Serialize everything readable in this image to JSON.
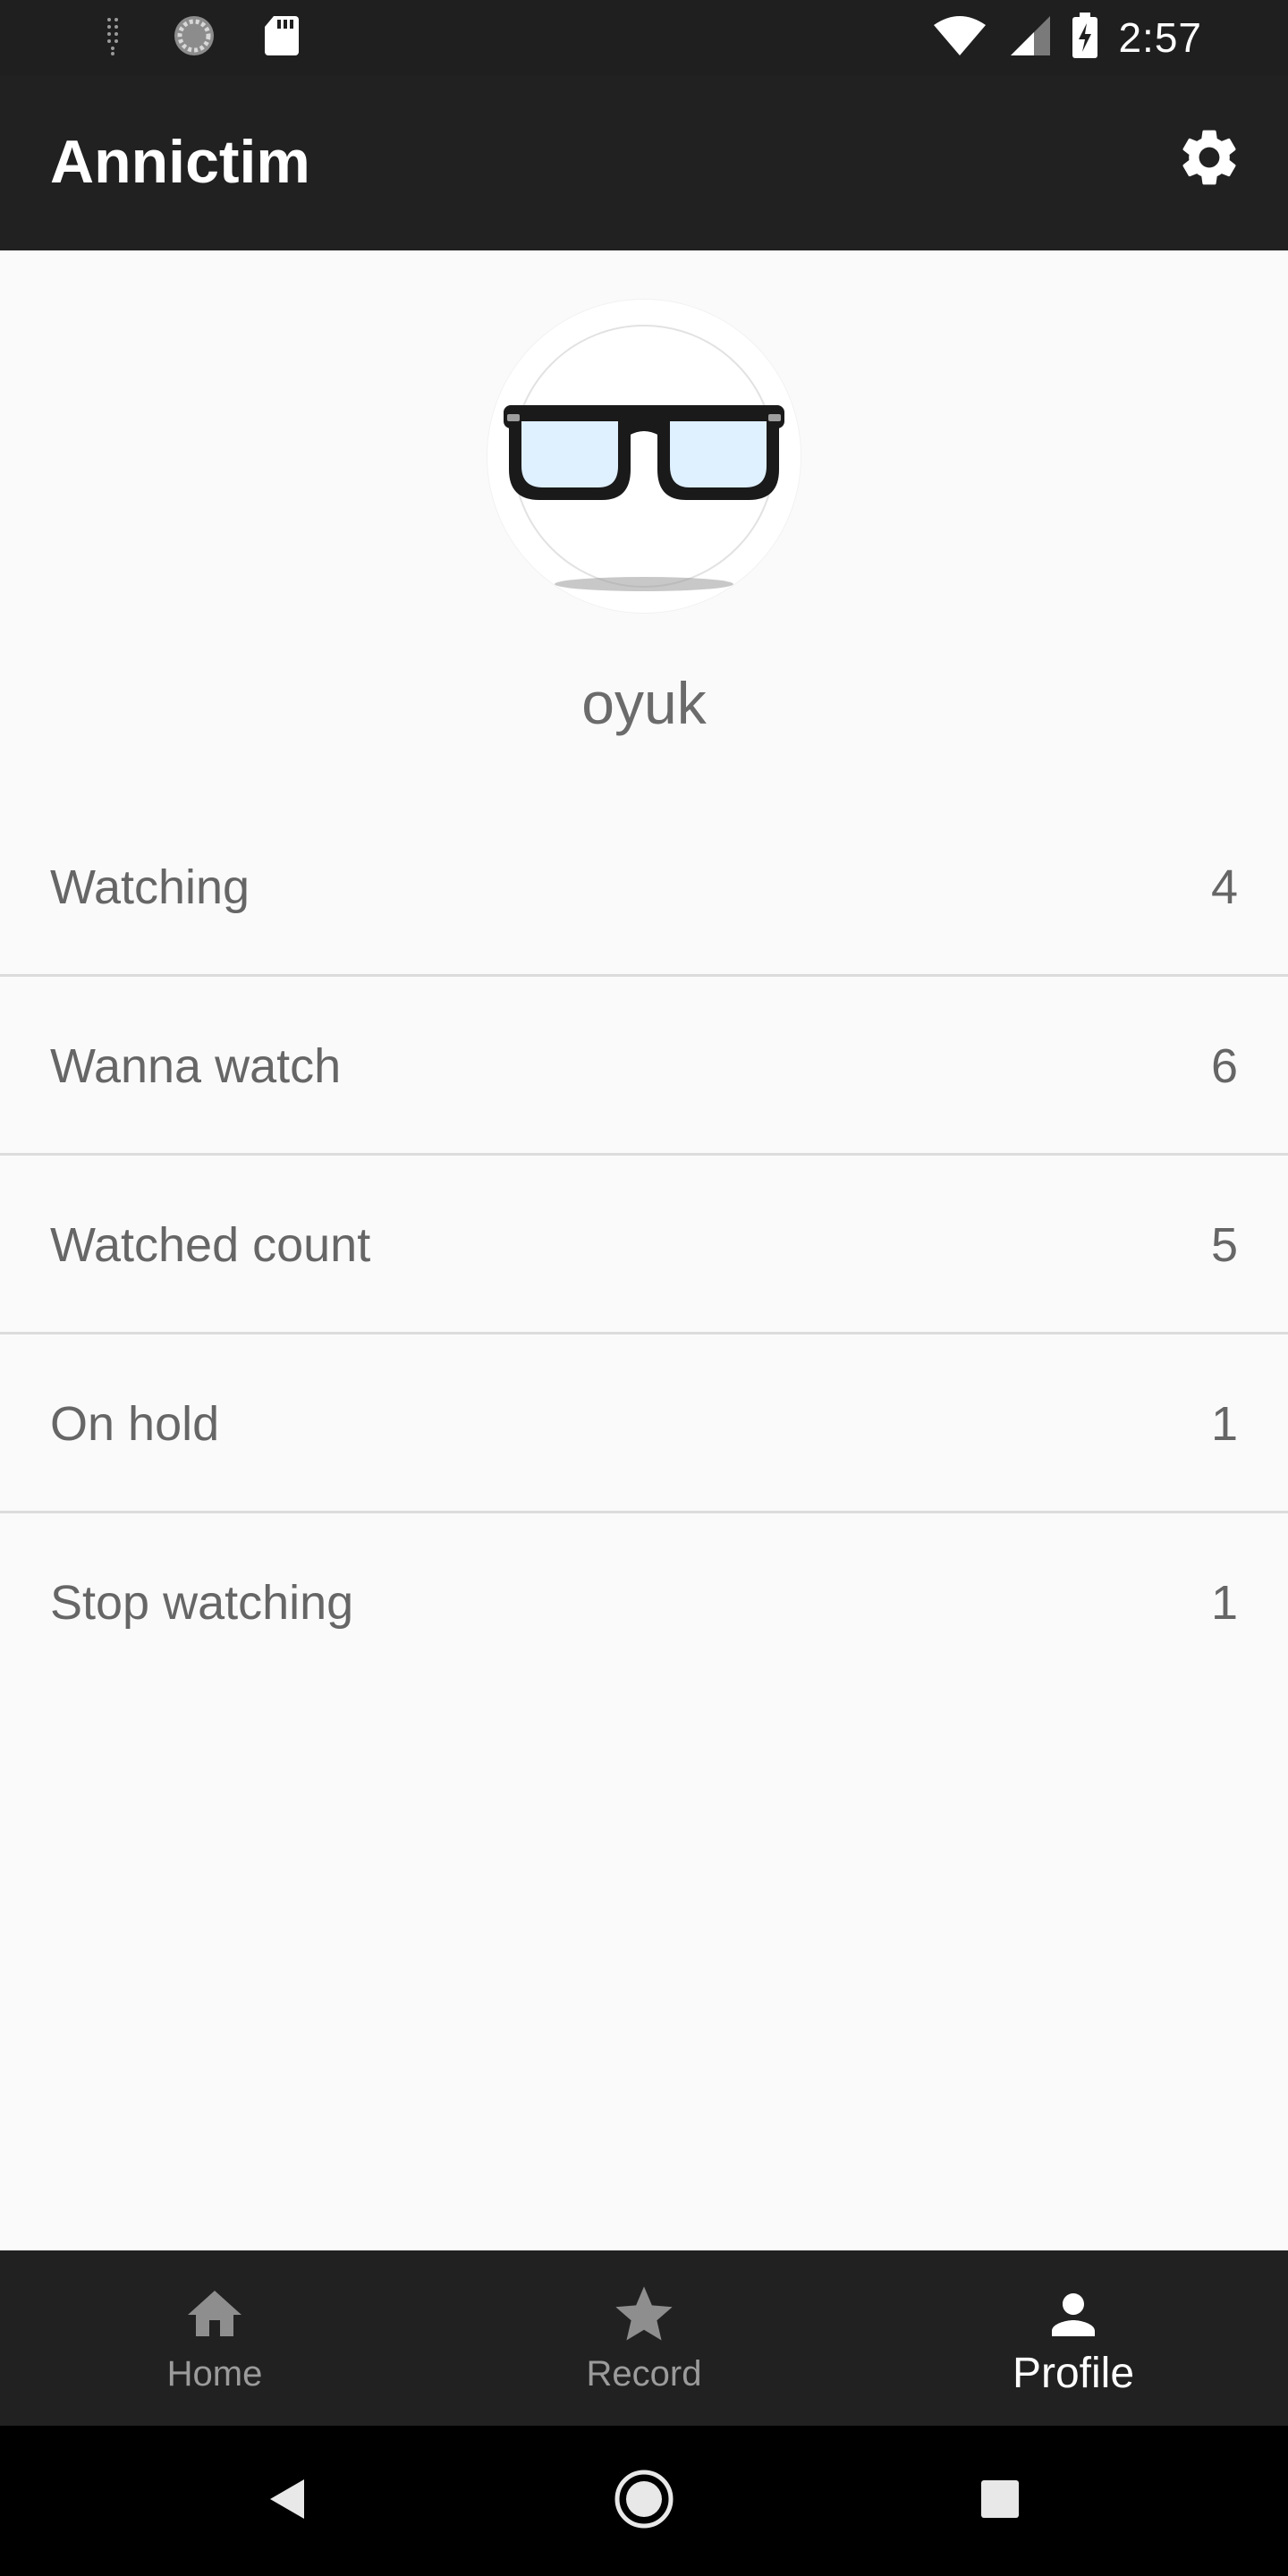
{
  "status_bar": {
    "time": "2:57",
    "icons": [
      "signal-dots-icon",
      "sync-icon",
      "sd-card-icon",
      "wifi-icon",
      "cellular-icon",
      "battery-charging-icon"
    ]
  },
  "app_bar": {
    "title": "Annictim",
    "settings_icon": "gear-icon"
  },
  "profile": {
    "avatar_icon": "glasses-icon",
    "username": "oyuk"
  },
  "stats": [
    {
      "label": "Watching",
      "value": "4"
    },
    {
      "label": "Wanna watch",
      "value": "6"
    },
    {
      "label": "Watched count",
      "value": "5"
    },
    {
      "label": "On hold",
      "value": "1"
    },
    {
      "label": "Stop watching",
      "value": "1"
    }
  ],
  "bottom_nav": {
    "items": [
      {
        "label": "Home",
        "icon": "home-icon",
        "active": false
      },
      {
        "label": "Record",
        "icon": "star-icon",
        "active": false
      },
      {
        "label": "Profile",
        "icon": "person-icon",
        "active": true
      }
    ]
  },
  "system_nav": {
    "icons": [
      "back-icon",
      "home-circle-icon",
      "recents-icon"
    ]
  },
  "colors": {
    "app_bar": "#212121",
    "status_bar": "#1f1f1f",
    "background": "#fafafa",
    "text_secondary": "#666666",
    "nav_inactive": "#9b9b9b",
    "nav_active": "#ffffff"
  }
}
